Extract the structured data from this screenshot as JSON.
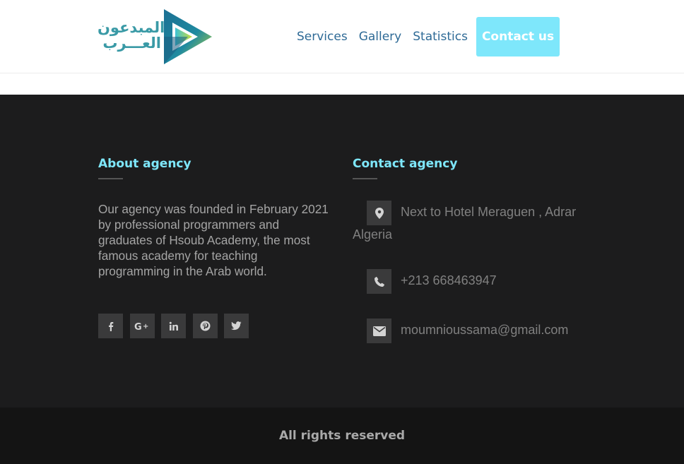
{
  "header": {
    "logo": {
      "line1": "المبدعون",
      "line2": "العـــرب",
      "colors": {
        "text": "#3a9aa6",
        "play_dark": "#1f7a95",
        "play_green": "#b6d43a"
      }
    },
    "nav": {
      "services": "Services",
      "gallery": "Gallery",
      "statistics": "Statistics",
      "contact": "Contact us"
    }
  },
  "footer": {
    "about": {
      "title": "About agency",
      "text": "Our agency was founded in February 2021 by professional programmers and graduates of Hsoub Academy, the most famous academy for teaching programming in the Arab world."
    },
    "socials": [
      {
        "icon": "facebook-icon",
        "glyph": "f"
      },
      {
        "icon": "google-plus-icon",
        "glyph": "G+"
      },
      {
        "icon": "linkedin-icon",
        "glyph": "in"
      },
      {
        "icon": "pinterest-icon",
        "glyph": "P"
      },
      {
        "icon": "twitter-icon",
        "glyph": "t"
      }
    ],
    "contact": {
      "title": "Contact agency",
      "address_line1": "Next to Hotel Meraguen , Adrar",
      "address_line2": "Algeria",
      "phone": "+213 668463947",
      "email": "moumnioussama@gmail.com"
    },
    "copyright": "All rights reserved"
  },
  "colors": {
    "accent": "#7ee7fb",
    "nav_link": "#2e6a96",
    "footer_bg": "#1c1c1d",
    "bottom_bg": "#141414"
  }
}
